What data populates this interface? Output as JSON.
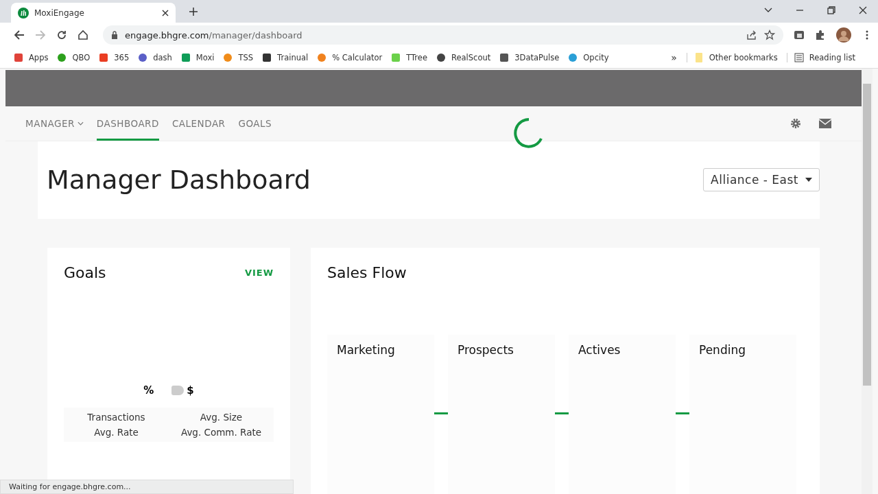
{
  "browser": {
    "tab": {
      "title": "MoxiEngage"
    },
    "url": {
      "host": "engage.bhgre.com",
      "path": "/manager/dashboard"
    },
    "bookmarks": [
      {
        "label": "Apps"
      },
      {
        "label": "QBO"
      },
      {
        "label": "365"
      },
      {
        "label": "dash"
      },
      {
        "label": "Moxi"
      },
      {
        "label": "TSS"
      },
      {
        "label": "Trainual"
      },
      {
        "label": "% Calculator"
      },
      {
        "label": "TTree"
      },
      {
        "label": "RealScout"
      },
      {
        "label": "3DataPulse"
      },
      {
        "label": "Opcity"
      }
    ],
    "more_bookmarks": "»",
    "other_bookmarks": "Other bookmarks",
    "reading_list": "Reading list",
    "status": "Waiting for engage.bhgre.com..."
  },
  "nav": {
    "items": [
      {
        "label": "MANAGER",
        "selected": false,
        "dropdown": true
      },
      {
        "label": "DASHBOARD",
        "selected": true,
        "dropdown": false
      },
      {
        "label": "CALENDAR",
        "selected": false,
        "dropdown": false
      },
      {
        "label": "GOALS",
        "selected": false,
        "dropdown": false
      }
    ]
  },
  "page": {
    "title": "Manager Dashboard",
    "office_select": "Alliance - East"
  },
  "goals": {
    "title": "Goals",
    "view": "VIEW",
    "toggle": {
      "left": "%",
      "right": "$",
      "on": false
    },
    "metrics": [
      [
        "Transactions",
        "Avg. Size"
      ],
      [
        "Avg. Rate",
        "Avg. Comm. Rate"
      ]
    ]
  },
  "sales_flow": {
    "title": "Sales Flow",
    "stages": [
      {
        "label": "Marketing"
      },
      {
        "label": "Prospects"
      },
      {
        "label": "Actives"
      },
      {
        "label": "Pending"
      }
    ]
  }
}
